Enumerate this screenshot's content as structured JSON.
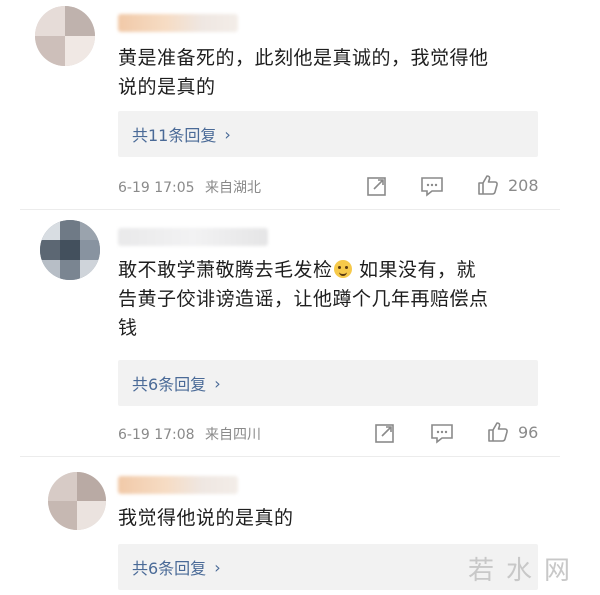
{
  "comments": [
    {
      "text": "黄是准备死的，此刻他是真诚的，我觉得他\n说的是真的",
      "replies_label": "共11条回复",
      "date": "6-19 17:05",
      "location": "来自湖北",
      "likes": "208"
    },
    {
      "text_before_emoji": "敢不敢学萧敬腾去毛发检",
      "text_after_emoji": " 如果没有，就\n告黄子佼诽谤造谣，让他蹲个几年再赔偿点\n钱",
      "replies_label": "共6条回复",
      "date": "6-19 17:08",
      "location": "来自四川",
      "likes": "96"
    },
    {
      "text": "我觉得他说的是真的",
      "replies_label": "共6条回复"
    }
  ],
  "icons": {
    "chevron": "chevron-right-icon",
    "share": "share-icon",
    "comment": "comment-icon",
    "like": "thumbs-up-icon"
  },
  "colors": {
    "link_blue": "#4a6a97",
    "meta_gray": "#8a8a8a",
    "reply_bg": "#f2f2f2"
  },
  "watermark": "若水网"
}
